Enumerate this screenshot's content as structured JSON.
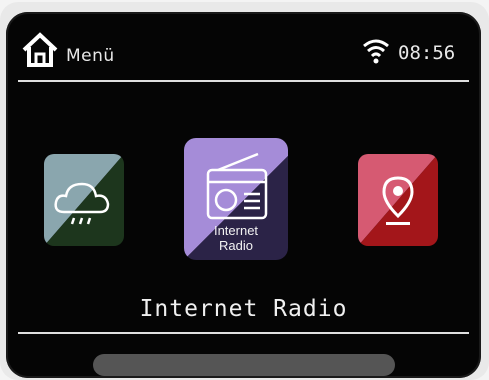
{
  "header": {
    "title": "Menü",
    "time": "08:56",
    "home_icon": "home-icon",
    "wifi_icon": "wifi-icon"
  },
  "carousel": {
    "items": [
      {
        "id": "weather",
        "icon": "weather-cloud-rain-icon",
        "colors": [
          "#7f9aa3",
          "#1f3a1f"
        ]
      },
      {
        "id": "internet-radio",
        "icon": "radio-icon",
        "caption_line1": "Internet",
        "caption_line2": "Radio",
        "colors": [
          "#a78ad6",
          "#2a2145"
        ]
      },
      {
        "id": "location",
        "icon": "map-pin-icon",
        "colors": [
          "#d0506a",
          "#a01418"
        ]
      }
    ],
    "selected": "internet-radio"
  },
  "footer": {
    "selected_title": "Internet Radio"
  },
  "colors": {
    "screen_bg": "#050505",
    "text": "#e8e8e8",
    "scrollbar": "#555555"
  }
}
